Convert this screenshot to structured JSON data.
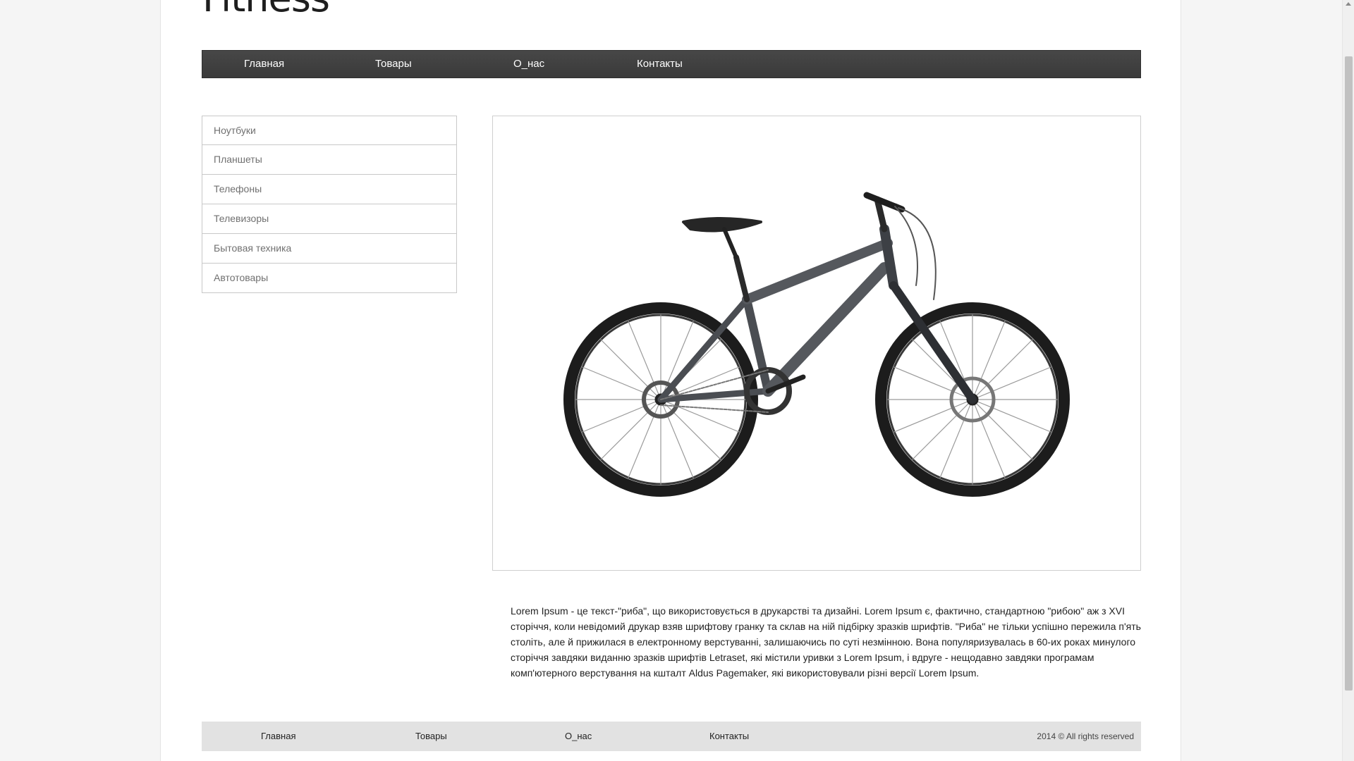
{
  "site": {
    "logo": "Fitness"
  },
  "topnav": {
    "items": [
      {
        "label": "Главная"
      },
      {
        "label": "Товары"
      },
      {
        "label": "О_нас"
      },
      {
        "label": "Контакты"
      }
    ]
  },
  "sidebar": {
    "categories": [
      {
        "label": "Ноутбуки"
      },
      {
        "label": "Планшеты"
      },
      {
        "label": "Телефоны"
      },
      {
        "label": "Телевизоры"
      },
      {
        "label": "Бытовая техника"
      },
      {
        "label": "Автотовары"
      }
    ]
  },
  "product": {
    "image_icon": "bicycle-image",
    "frame_color": "#4a4d52",
    "description": "Lorem Ipsum - це текст-\"риба\", що використовується в друкарстві та дизайні. Lorem Ipsum є, фактично, стандартною \"рибою\" аж з XVI сторіччя, коли невідомий друкар взяв шрифтову гранку та склав на ній підбірку зразків шрифтів. \"Риба\" не тільки успішно пережила п'ять століть, але й прижилася в електронному верстуванні, залишаючись по суті незмінною. Вона популяризувалась в 60-их роках минулого сторіччя завдяки виданню зразків шрифтів Letraset, які містили уривки з Lorem Ipsum, і вдруге - нещодавно завдяки програмам комп'ютерного верстування на кшталт Aldus Pagemaker, які використовували різні версії Lorem Ipsum."
  },
  "footer": {
    "items": [
      {
        "label": "Главная"
      },
      {
        "label": "Товары"
      },
      {
        "label": "О_нас"
      },
      {
        "label": "Контакты"
      }
    ],
    "copyright": "2014 © All rights reserved"
  }
}
